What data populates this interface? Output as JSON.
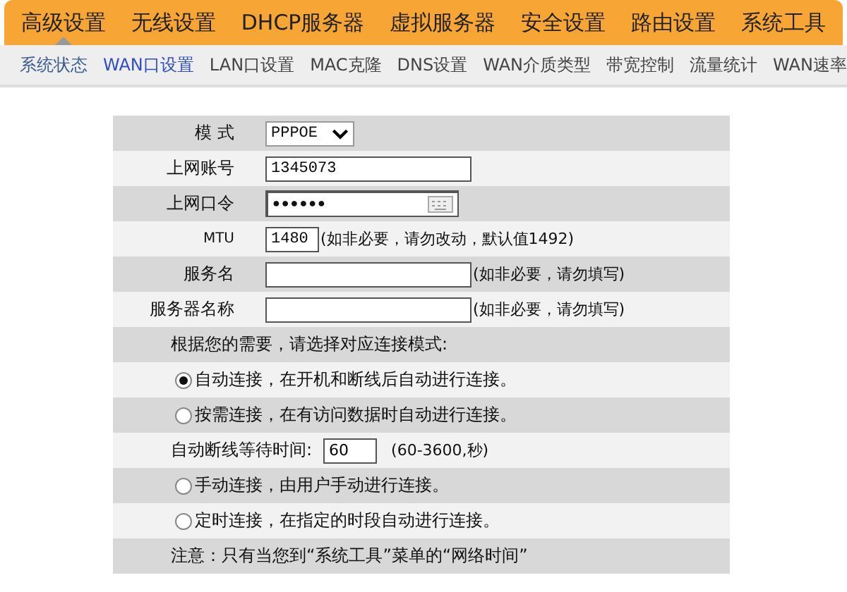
{
  "top_nav": [
    {
      "label": "高级设置",
      "selected": true
    },
    {
      "label": "无线设置",
      "selected": false
    },
    {
      "label": "DHCP服务器",
      "selected": false
    },
    {
      "label": "虚拟服务器",
      "selected": false
    },
    {
      "label": "安全设置",
      "selected": false
    },
    {
      "label": "路由设置",
      "selected": false
    },
    {
      "label": "系统工具",
      "selected": false
    }
  ],
  "sub_nav": [
    {
      "label": "系统状态",
      "selected": false,
      "visited": true
    },
    {
      "label": "WAN口设置",
      "selected": true,
      "visited": false
    },
    {
      "label": "LAN口设置",
      "selected": false,
      "visited": false
    },
    {
      "label": "MAC克隆",
      "selected": false,
      "visited": false
    },
    {
      "label": "DNS设置",
      "selected": false,
      "visited": false
    },
    {
      "label": "WAN介质类型",
      "selected": false,
      "visited": false
    },
    {
      "label": "带宽控制",
      "selected": false,
      "visited": false
    },
    {
      "label": "流量统计",
      "selected": false,
      "visited": false
    },
    {
      "label": "WAN速率",
      "selected": false,
      "visited": false
    }
  ],
  "form": {
    "rows": [
      {
        "kind": "select",
        "label": "模 式",
        "value": "PPPOE"
      },
      {
        "kind": "text",
        "label": "上网账号",
        "value": "1345073"
      },
      {
        "kind": "password",
        "label": "上网口令",
        "value": "●●●●●●"
      },
      {
        "kind": "short",
        "label": "MTU",
        "value": "1480",
        "hint": "(如非必要，请勿改动，默认值1492)"
      },
      {
        "kind": "text",
        "label": "服务名",
        "hint": "(如非必要，请勿填写)"
      },
      {
        "kind": "text",
        "label": "服务器名称",
        "hint": "(如非必要，请勿填写)"
      },
      {
        "kind": "note",
        "text": "根据您的需要，请选择对应连接模式:"
      },
      {
        "kind": "radio",
        "text": "自动连接，在开机和断线后自动进行连接。",
        "selected": true
      },
      {
        "kind": "radio",
        "text": "按需连接，在有访问数据时自动进行连接。",
        "selected": false
      },
      {
        "kind": "wait",
        "text": "自动断线等待时间:",
        "value": "60",
        "hint": "(60-3600,秒)"
      },
      {
        "kind": "radio",
        "text": "手动连接，由用户手动进行连接。",
        "selected": false
      },
      {
        "kind": "radio",
        "text": "定时连接，在指定的时段自动进行连接。",
        "selected": false
      },
      {
        "kind": "note",
        "text": "注意：只有当您到“系统工具”菜单的“网络时间”"
      }
    ]
  }
}
